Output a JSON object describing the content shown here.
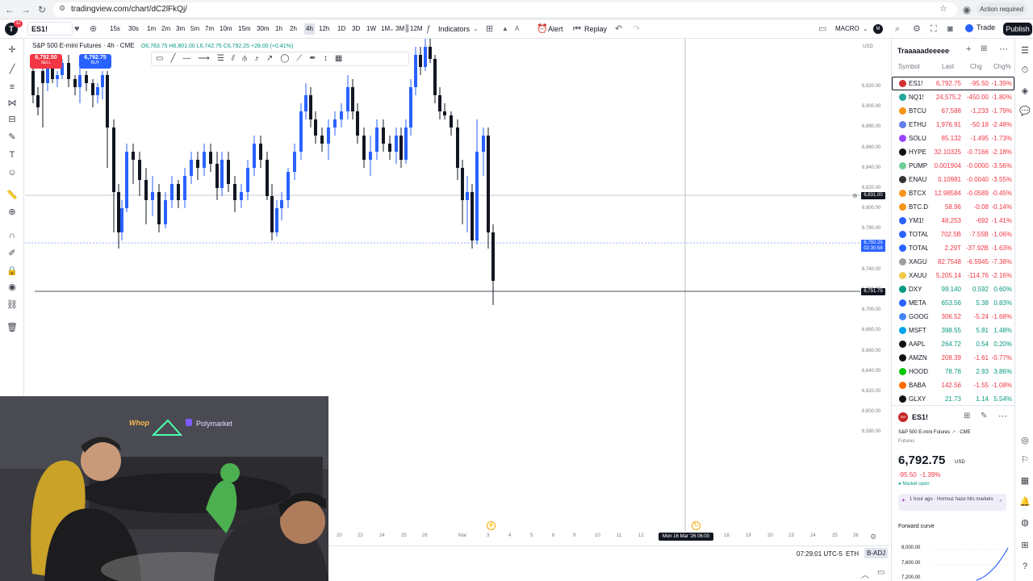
{
  "browser": {
    "url": "tradingview.com/chart/dC2lFkQj/",
    "action_required": "Action required"
  },
  "toolbar": {
    "symbol": "ES1!",
    "notif_count": "11",
    "intervals": [
      "15s",
      "30s",
      "1m",
      "2m",
      "3m",
      "5m",
      "7m",
      "10m",
      "15m",
      "30m",
      "1h",
      "2h",
      "4h",
      "12h",
      "1D",
      "3D",
      "1W",
      "1M",
      "3M",
      "12M"
    ],
    "active_interval": "4h",
    "indicators_label": "Indicators",
    "alert_label": "Alert",
    "replay_label": "Replay",
    "layout_name": "MACRO",
    "trade_label": "Trade",
    "publish_label": "Publish"
  },
  "chart": {
    "legend_title": "S&P 500 E-mini Futures · 4h · CME",
    "ohlc": "O6,763.75 H6,801.00 L6,742.75 C6,792.25 +28.00 (+0.41%)",
    "sell_price": "6,792.50",
    "sell_label": "SELL",
    "buy_price": "6,792.75",
    "buy_label": "BUY",
    "currency": "USD",
    "price_labels": [
      "6,920.00",
      "6,900.00",
      "6,880.00",
      "6,860.00",
      "6,840.00",
      "6,820.00",
      "6,800.00",
      "6,780.00",
      "6,760.00",
      "6,740.00",
      "6,720.00",
      "6,700.00",
      "6,680.00",
      "6,660.00",
      "6,640.00",
      "6,620.00",
      "6,600.00",
      "6,580.00"
    ],
    "crosshair_price": "6,831.00",
    "last_price_tag": "6,792.25",
    "countdown": "02:30:58",
    "low_line_tag": "6,751.75",
    "time_labels": [
      "20",
      "23",
      "24",
      "25",
      "26",
      "Mar",
      "3",
      "4",
      "5",
      "6",
      "9",
      "10",
      "11",
      "12",
      "16",
      "18",
      "19",
      "20",
      "23",
      "24",
      "25",
      "26"
    ],
    "crosshair_time": "Mon 16 Mar '26  06:00",
    "clock": "07:29:01 UTC-5",
    "session": "ETH",
    "adj": "B-ADJ"
  },
  "watchlist": {
    "title": "Traaaaadeeeee",
    "headers": [
      "Symbol",
      "Last",
      "Chg",
      "Chg%"
    ],
    "rows": [
      {
        "sym": "ES1!",
        "last": "6,792.75",
        "chg": "-95.50",
        "pct": "-1.39%",
        "color": "#d32f2f",
        "dir": "neg"
      },
      {
        "sym": "NQ1!",
        "last": "24,575.2",
        "chg": "-450.00",
        "pct": "-1.80%",
        "color": "#26a69a",
        "dir": "neg"
      },
      {
        "sym": "BTCU",
        "last": "67,588",
        "chg": "-1,233",
        "pct": "-1.79%",
        "color": "#f7931a",
        "dir": "neg"
      },
      {
        "sym": "ETHU",
        "last": "1,976.91",
        "chg": "-50.18",
        "pct": "-2.48%",
        "color": "#627eea",
        "dir": "neg"
      },
      {
        "sym": "SOLU",
        "last": "85.132",
        "chg": "-1.495",
        "pct": "-1.73%",
        "color": "#9945ff",
        "dir": "neg"
      },
      {
        "sym": "HYPE",
        "last": "32.10325",
        "chg": "-0.7166",
        "pct": "-2.18%",
        "color": "#111111",
        "dir": "neg"
      },
      {
        "sym": "PUMP",
        "last": "0.001904",
        "chg": "-0.0000",
        "pct": "-3.56%",
        "color": "#6fcf97",
        "dir": "neg"
      },
      {
        "sym": "ENAU",
        "last": "0.10981",
        "chg": "-0.0040",
        "pct": "-3.55%",
        "color": "#333333",
        "dir": "neg"
      },
      {
        "sym": "BTCX",
        "last": "12.98584",
        "chg": "-0.0589",
        "pct": "-0.45%",
        "color": "#f7931a",
        "dir": "neg"
      },
      {
        "sym": "BTC.D",
        "last": "58.96",
        "chg": "-0.08",
        "pct": "-0.14%",
        "color": "#f7931a",
        "dir": "neg"
      },
      {
        "sym": "YM1!",
        "last": "48,253",
        "chg": "-692",
        "pct": "-1.41%",
        "color": "#2962ff",
        "dir": "neg"
      },
      {
        "sym": "TOTAL",
        "last": "702.5B",
        "chg": "-7.55B",
        "pct": "-1.06%",
        "color": "#2962ff",
        "dir": "neg"
      },
      {
        "sym": "TOTAL",
        "last": "2.29T",
        "chg": "-37.92B",
        "pct": "-1.63%",
        "color": "#2962ff",
        "dir": "neg"
      },
      {
        "sym": "XAGU",
        "last": "82.7548",
        "chg": "-6.5945",
        "pct": "-7.38%",
        "color": "#9e9e9e",
        "dir": "neg"
      },
      {
        "sym": "XAUU",
        "last": "5,205.14",
        "chg": "-114.76",
        "pct": "-2.16%",
        "color": "#f2c94c",
        "dir": "neg"
      },
      {
        "sym": "DXY",
        "last": "99.140",
        "chg": "0.592",
        "pct": "0.60%",
        "color": "#089981",
        "dir": "pos"
      },
      {
        "sym": "META",
        "last": "653.56",
        "chg": "5.38",
        "pct": "0.83%",
        "color": "#2962ff",
        "dir": "pos"
      },
      {
        "sym": "GOOG",
        "last": "306.52",
        "chg": "-5.24",
        "pct": "-1.68%",
        "color": "#4285f4",
        "dir": "neg"
      },
      {
        "sym": "MSFT",
        "last": "398.55",
        "chg": "5.81",
        "pct": "1.48%",
        "color": "#00a4ef",
        "dir": "pos"
      },
      {
        "sym": "AAPL",
        "last": "264.72",
        "chg": "0.54",
        "pct": "0.20%",
        "color": "#111111",
        "dir": "pos"
      },
      {
        "sym": "AMZN",
        "last": "208.39",
        "chg": "-1.61",
        "pct": "-0.77%",
        "color": "#111111",
        "dir": "neg"
      },
      {
        "sym": "HOOD",
        "last": "78.78",
        "chg": "2.93",
        "pct": "3.86%",
        "color": "#00c805",
        "dir": "pos"
      },
      {
        "sym": "BABA",
        "last": "142.56",
        "chg": "-1.55",
        "pct": "-1.08%",
        "color": "#ff6a00",
        "dir": "neg"
      },
      {
        "sym": "GLXY",
        "last": "21.73",
        "chg": "1.14",
        "pct": "5.54%",
        "color": "#111111",
        "dir": "pos"
      }
    ]
  },
  "details": {
    "symbol": "ES1!",
    "badge": "500",
    "name": "S&P 500 E-mini Futures",
    "exchange": "CME",
    "type": "Futures",
    "price": "6,792.75",
    "currency": "USD",
    "change": "-95.50  -1.39%",
    "status": "Market open",
    "news": "1 hour ago · Hormuz haze hits markets",
    "forward_curve": "Forward curve",
    "fc_labels": [
      "8,000.00",
      "7,600.00",
      "7,200.00"
    ]
  },
  "webcam": {
    "sign1": "Whop",
    "sign2": "Polymarket"
  },
  "colors": {
    "up": "#2962ff",
    "down": "#131722",
    "neg": "#f23645",
    "pos": "#089981",
    "accent": "#2962ff"
  }
}
